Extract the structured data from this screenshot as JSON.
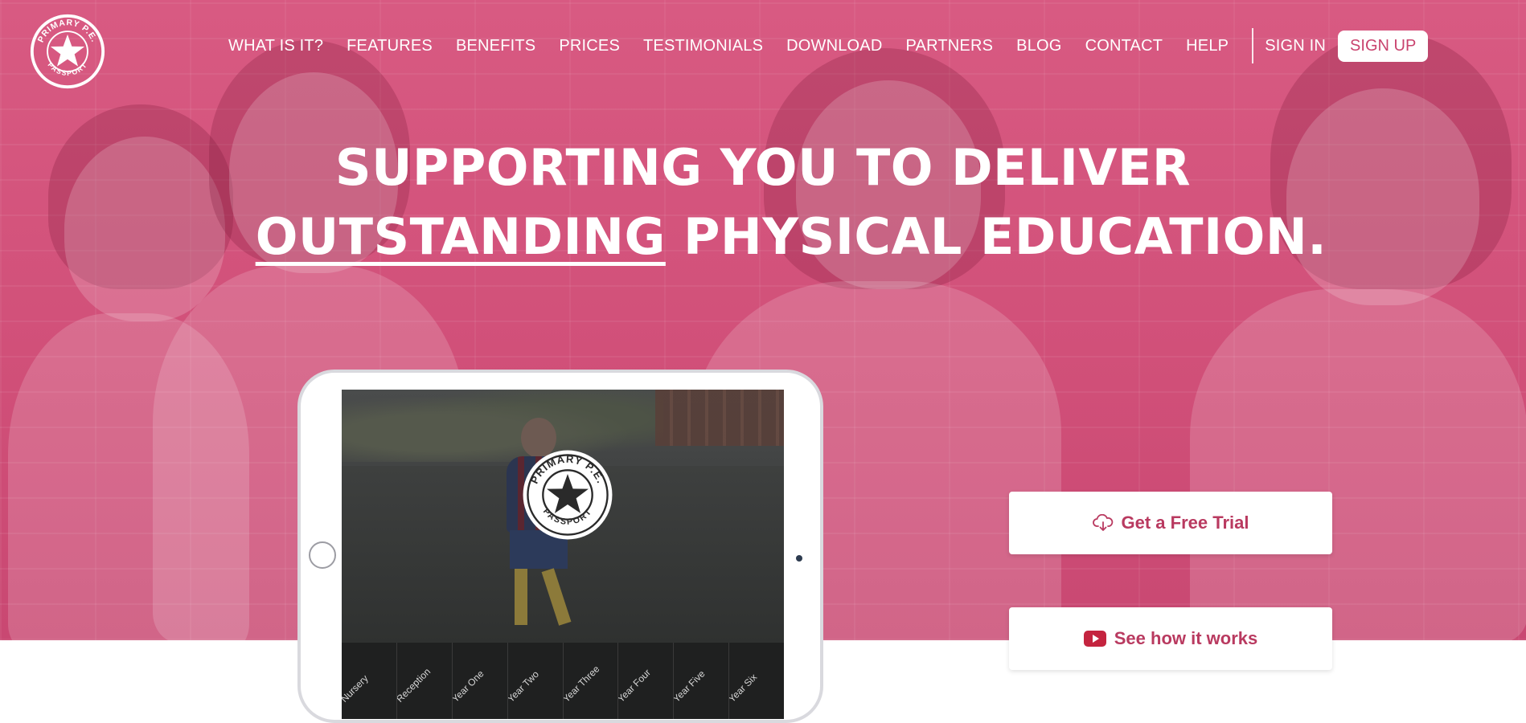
{
  "brand": {
    "logo_top_text": "PRIMARY P.E.",
    "logo_bottom_text": "PASSPORT"
  },
  "nav": {
    "links": [
      "WHAT IS IT?",
      "FEATURES",
      "BENEFITS",
      "PRICES",
      "TESTIMONIALS",
      "DOWNLOAD",
      "PARTNERS",
      "BLOG",
      "CONTACT",
      "HELP"
    ],
    "sign_in": "SIGN IN",
    "sign_up": "SIGN UP"
  },
  "hero": {
    "headline_line1": "SUPPORTING YOU TO DELIVER",
    "headline_underlined": "OUTSTANDING",
    "headline_line2_rest": " PHYSICAL EDUCATION."
  },
  "tablet": {
    "year_groups": [
      "Nursery",
      "Reception",
      "Year One",
      "Year Two",
      "Year Three",
      "Year Four",
      "Year Five",
      "Year Six"
    ]
  },
  "cta": {
    "free_trial": "Get a Free Trial",
    "free_trial_icon": "cloud-download-icon",
    "how_it_works": "See how it works",
    "how_it_works_icon": "youtube-play-icon"
  },
  "colors": {
    "hero_pink": "#d15079",
    "cta_text": "#b93a60",
    "youtube_red": "#c4243f"
  }
}
